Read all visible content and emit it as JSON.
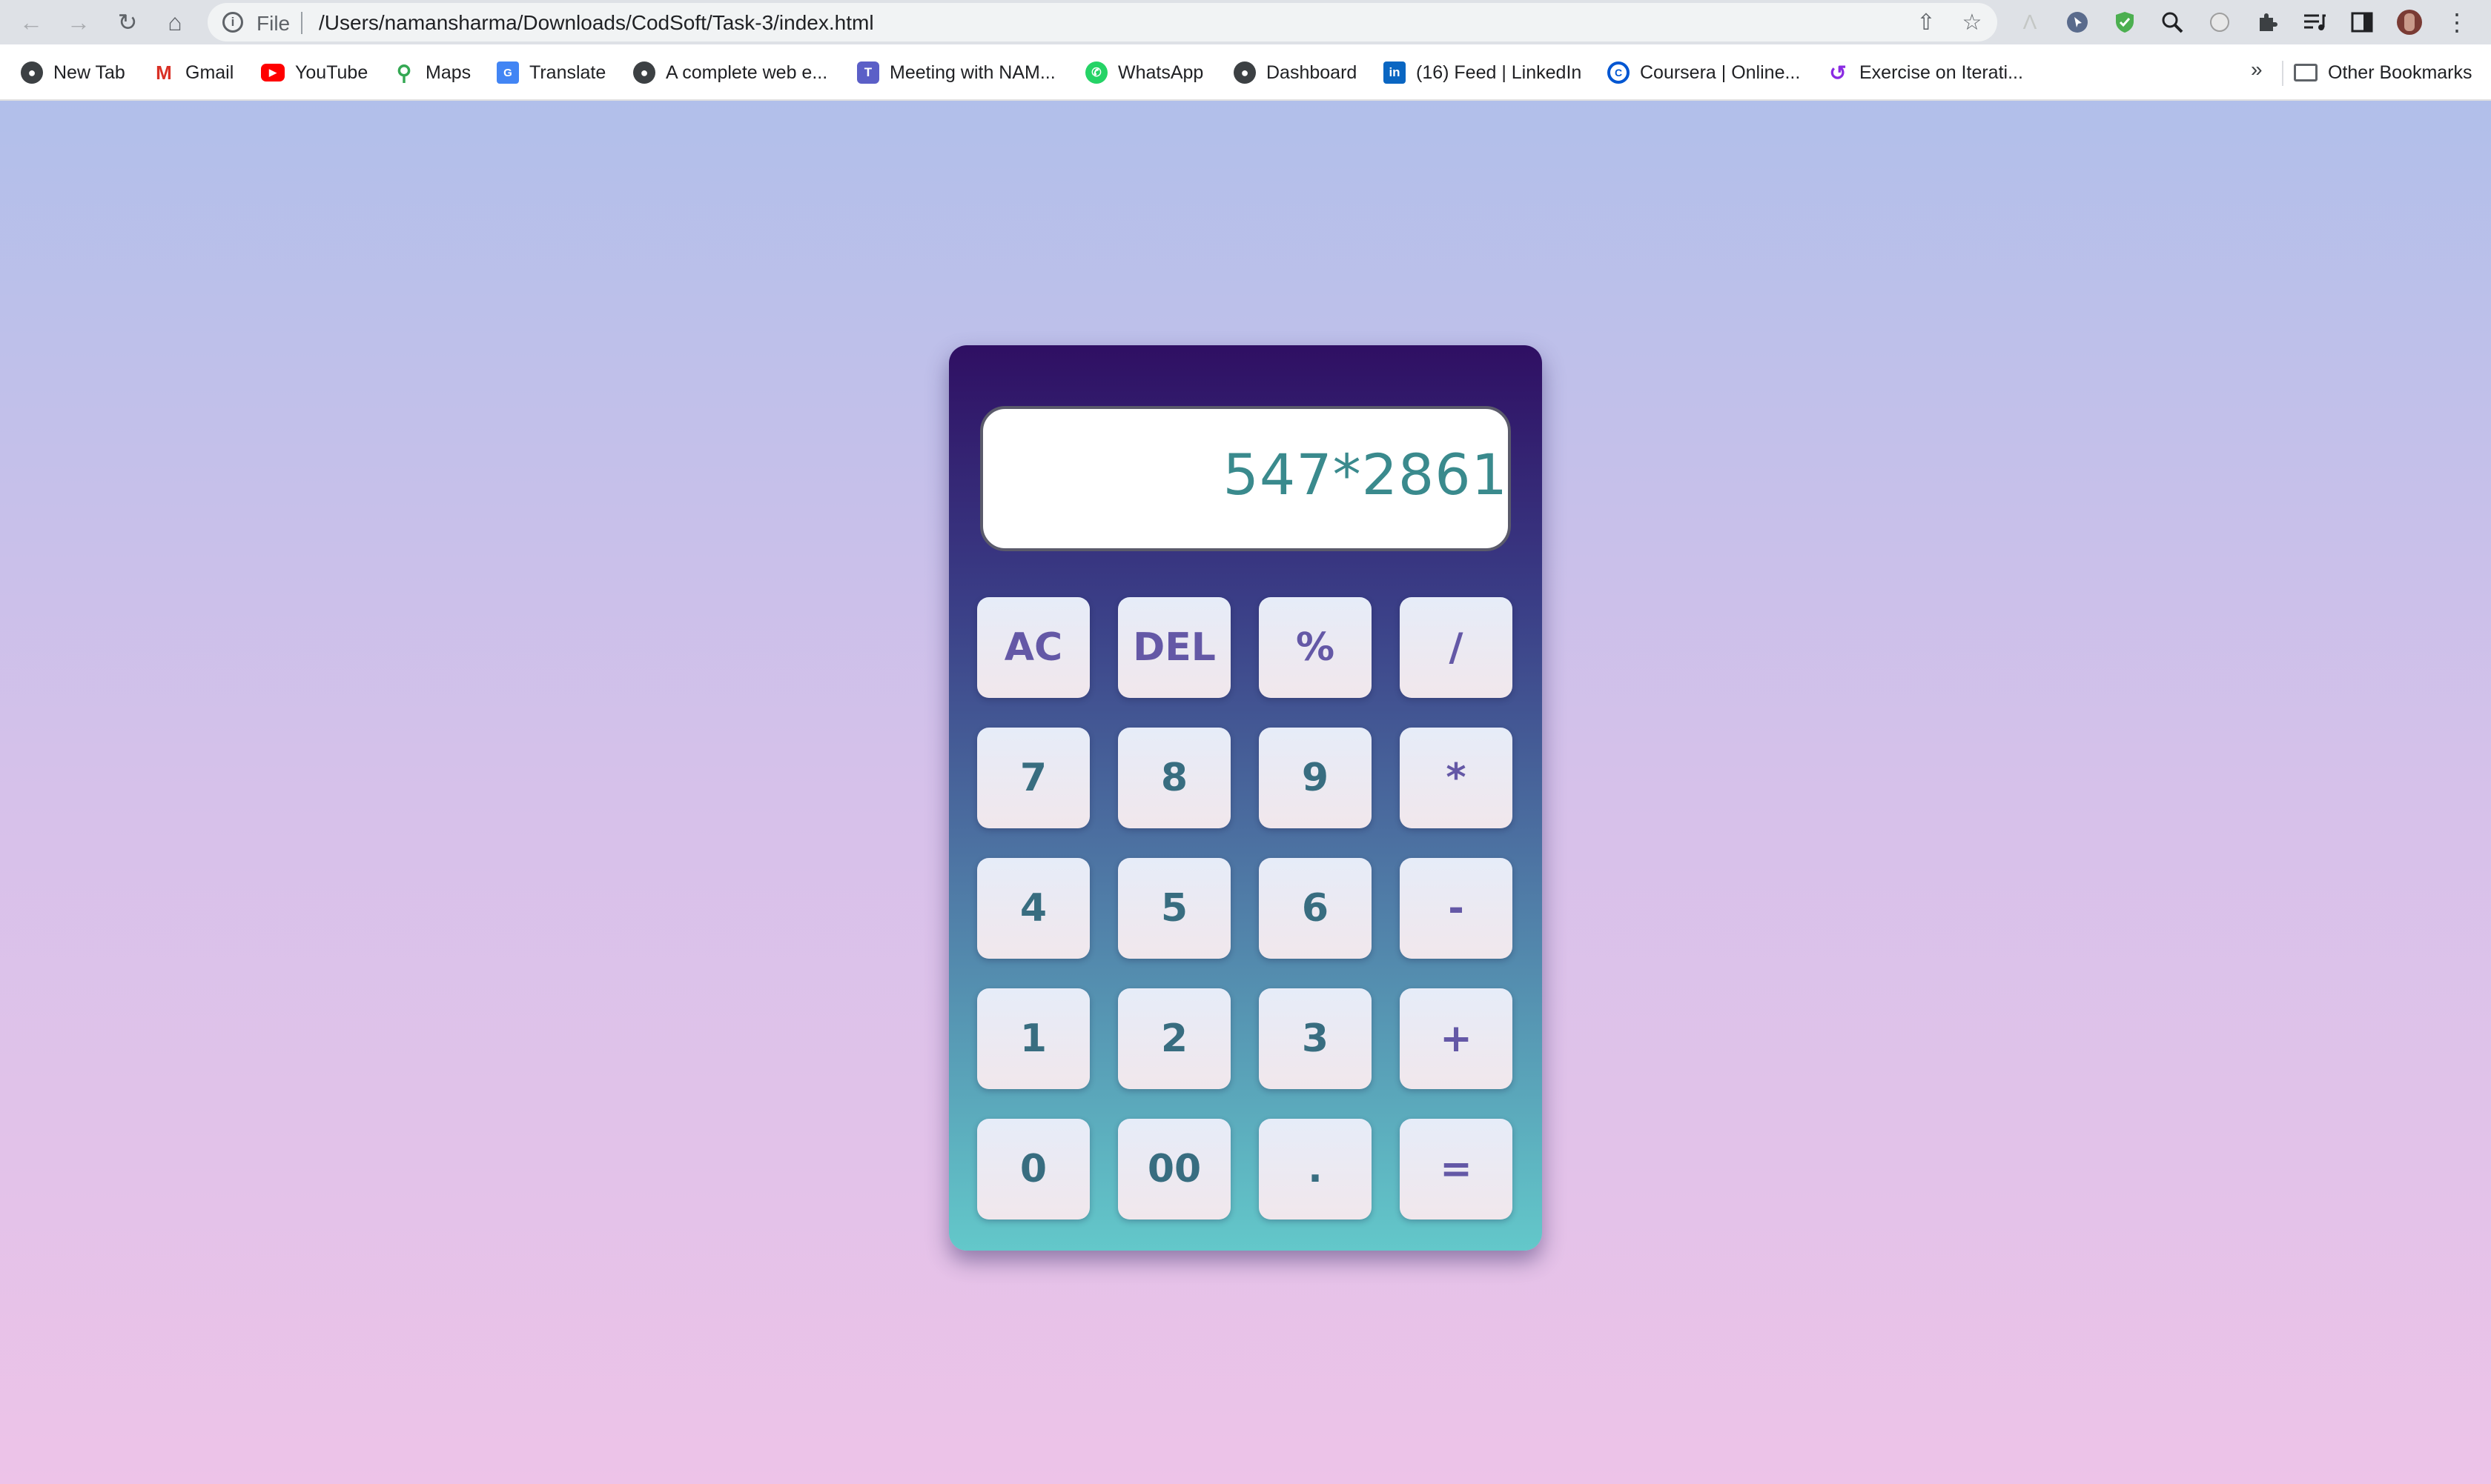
{
  "browser": {
    "url_scheme": "File",
    "url": "/Users/namansharma/Downloads/CodSoft/Task-3/index.html",
    "bookmarks": [
      {
        "label": "New Tab",
        "icon": "globe-icon"
      },
      {
        "label": "Gmail",
        "icon": "gmail-icon"
      },
      {
        "label": "YouTube",
        "icon": "youtube-icon"
      },
      {
        "label": "Maps",
        "icon": "maps-icon"
      },
      {
        "label": "Translate",
        "icon": "translate-icon"
      },
      {
        "label": "A complete web e...",
        "icon": "globe-icon"
      },
      {
        "label": "Meeting with NAM...",
        "icon": "teams-icon"
      },
      {
        "label": "WhatsApp",
        "icon": "whatsapp-icon"
      },
      {
        "label": "Dashboard",
        "icon": "globe-icon"
      },
      {
        "label": "(16) Feed | LinkedIn",
        "icon": "linkedin-icon"
      },
      {
        "label": "Coursera | Online...",
        "icon": "coursera-icon"
      },
      {
        "label": "Exercise on Iterati...",
        "icon": "exercise-icon"
      }
    ],
    "overflow_label": "»",
    "other_bookmarks": "Other Bookmarks"
  },
  "calculator": {
    "display": "547*2861",
    "rows": [
      [
        {
          "label": "AC",
          "kind": "op"
        },
        {
          "label": "DEL",
          "kind": "op"
        },
        {
          "label": "%",
          "kind": "op"
        },
        {
          "label": "/",
          "kind": "op"
        }
      ],
      [
        {
          "label": "7",
          "kind": "num"
        },
        {
          "label": "8",
          "kind": "num"
        },
        {
          "label": "9",
          "kind": "num"
        },
        {
          "label": "*",
          "kind": "op"
        }
      ],
      [
        {
          "label": "4",
          "kind": "num"
        },
        {
          "label": "5",
          "kind": "num"
        },
        {
          "label": "6",
          "kind": "num"
        },
        {
          "label": "-",
          "kind": "op"
        }
      ],
      [
        {
          "label": "1",
          "kind": "num"
        },
        {
          "label": "2",
          "kind": "num"
        },
        {
          "label": "3",
          "kind": "num"
        },
        {
          "label": "+",
          "kind": "op"
        }
      ],
      [
        {
          "label": "0",
          "kind": "num"
        },
        {
          "label": "00",
          "kind": "num"
        },
        {
          "label": ".",
          "kind": "num"
        },
        {
          "label": "=",
          "kind": "op"
        }
      ]
    ]
  },
  "colors": {
    "operator_key_text": "#6458a6",
    "number_key_text": "#386d80",
    "display_text": "#3a8a8d"
  }
}
